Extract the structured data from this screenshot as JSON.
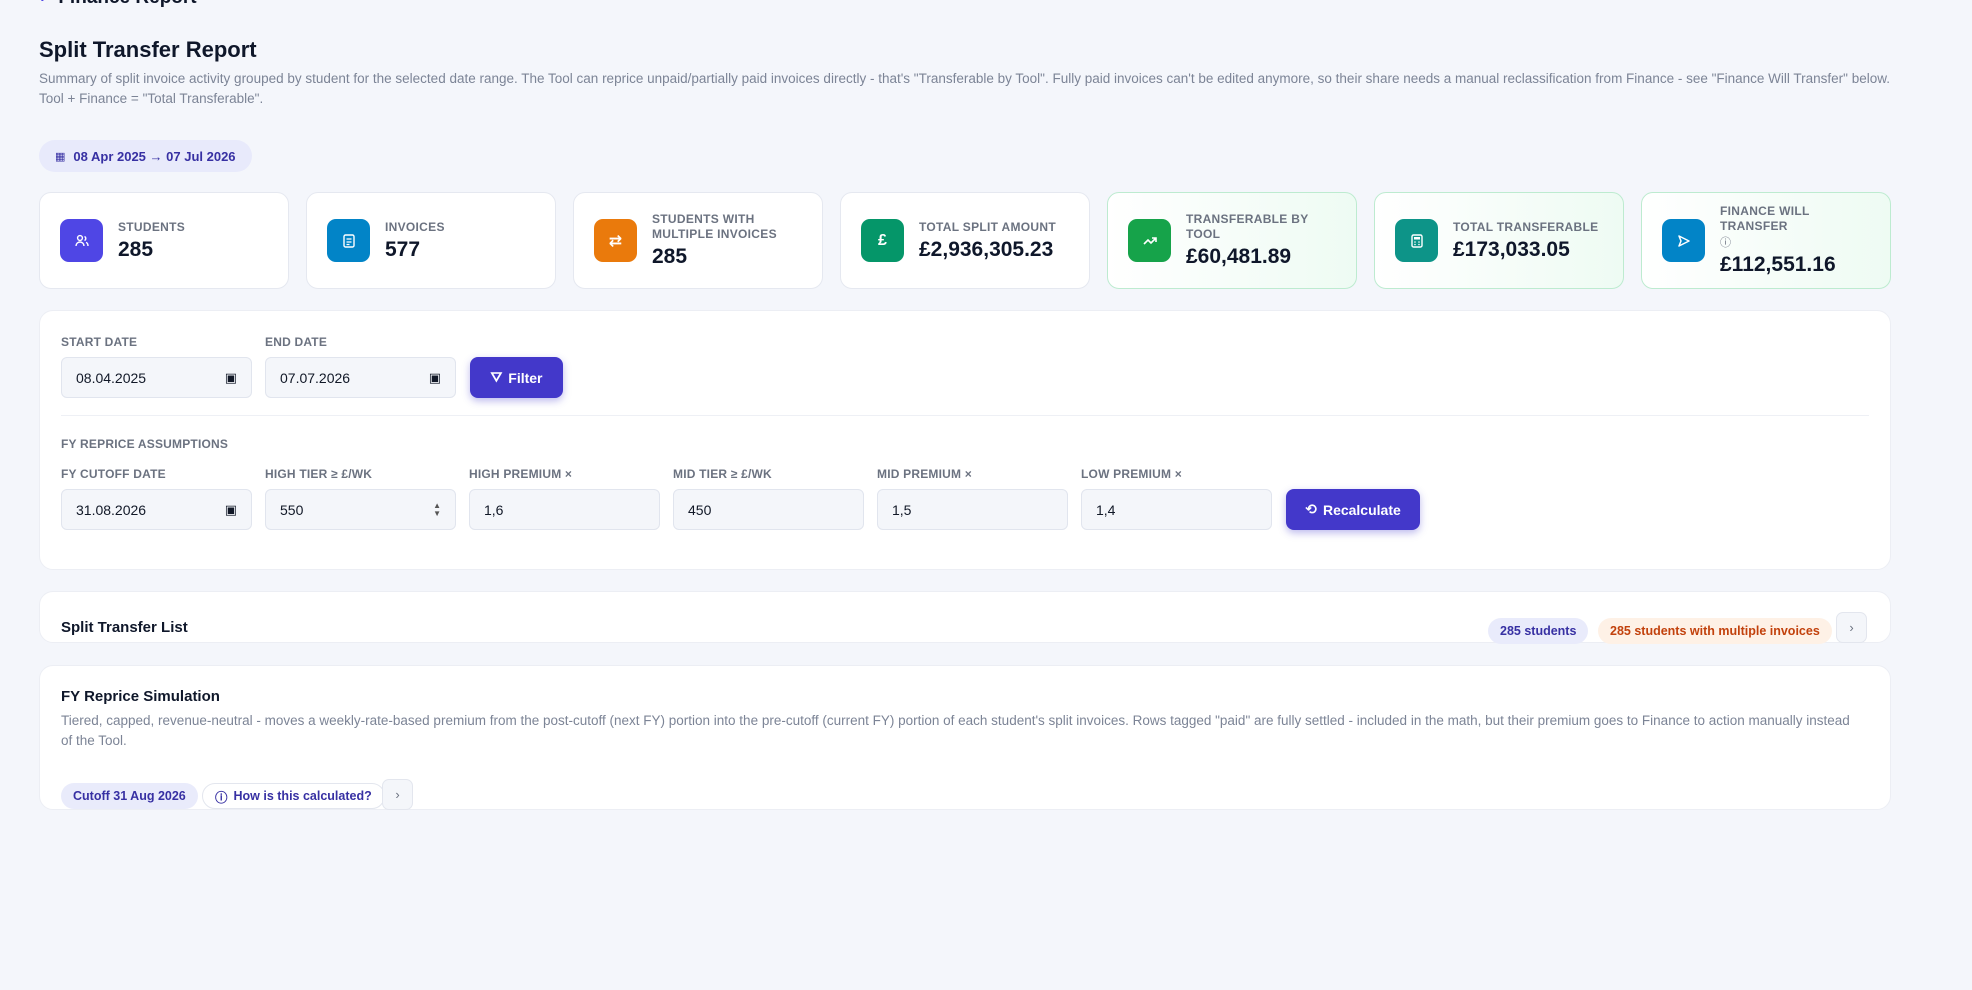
{
  "breadcrumb": {
    "back_label": "Finance Report"
  },
  "header": {
    "title": "Split Transfer Report",
    "subtitle": "Summary of split invoice activity grouped by student for the selected date range. The Tool can reprice unpaid/partially paid invoices directly - that's \"Transferable by Tool\". Fully paid invoices can't be edited anymore, so their share needs a manual reclassification from Finance - see \"Finance Will Transfer\" below. Tool + Finance = \"Total Transferable\"."
  },
  "date_range": {
    "label": "08 Apr 2025 → 07 Jul 2026"
  },
  "kpis": [
    {
      "label": "STUDENTS",
      "value": "285",
      "icon": "users-icon",
      "color": "#4f46e5"
    },
    {
      "label": "INVOICES",
      "value": "577",
      "icon": "invoice-icon",
      "color": "#0284c7"
    },
    {
      "label": "STUDENTS WITH MULTIPLE INVOICES",
      "value": "285",
      "icon": "swap-icon",
      "color": "#ea7a0c"
    },
    {
      "label": "TOTAL SPLIT AMOUNT",
      "value": "£2,936,305.23",
      "icon": "pound-icon",
      "color": "#059669"
    },
    {
      "label": "TRANSFERABLE BY TOOL",
      "value": "£60,481.89",
      "icon": "trend-up-icon",
      "color": "#16a34a"
    },
    {
      "label": "TOTAL TRANSFERABLE",
      "value": "£173,033.05",
      "icon": "calculator-icon",
      "color": "#0d9488"
    },
    {
      "label": "FINANCE WILL TRANSFER",
      "value": "£112,551.16",
      "icon": "send-icon",
      "color": "#0284c7"
    }
  ],
  "filters": {
    "start_date_label": "START DATE",
    "start_date": "08.04.2025",
    "end_date_label": "END DATE",
    "end_date": "07.07.2026",
    "filter_button": "Filter"
  },
  "assumptions": {
    "section_label": "FY REPRICE ASSUMPTIONS",
    "fy_cutoff_label": "FY CUTOFF DATE",
    "fy_cutoff": "31.08.2026",
    "high_tier_label": "HIGH TIER ≥ £/WK",
    "high_tier": "550",
    "high_premium_label": "HIGH PREMIUM ×",
    "high_premium": "1,6",
    "mid_tier_label": "MID TIER ≥ £/WK",
    "mid_tier": "450",
    "mid_premium_label": "MID PREMIUM ×",
    "mid_premium": "1,5",
    "low_premium_label": "LOW PREMIUM ×",
    "low_premium": "1,4",
    "recalculate_button": "Recalculate"
  },
  "split_list": {
    "title": "Split Transfer List",
    "students_pill": "285 students",
    "multi_pill": "285 students with multiple invoices"
  },
  "simulation": {
    "title": "FY Reprice Simulation",
    "description": "Tiered, capped, revenue-neutral - moves a weekly-rate-based premium from the post-cutoff (next FY) portion into the pre-cutoff (current FY) portion of each student's split invoices. Rows tagged \"paid\" are fully settled - included in the math, but their premium goes to Finance to action manually instead of the Tool.",
    "cutoff_pill": "Cutoff 31 Aug 2026",
    "how_pill": "How is this calculated?"
  }
}
